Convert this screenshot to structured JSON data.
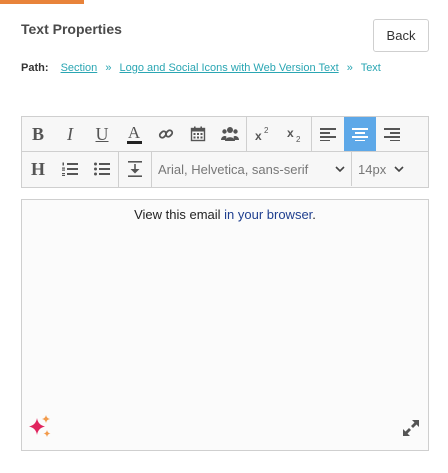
{
  "header": {
    "title": "Text Properties",
    "back_label": "Back"
  },
  "path": {
    "label": "Path:",
    "crumbs": [
      "Section",
      "Logo and Social Icons with Web Version Text"
    ],
    "current": "Text",
    "separator": "»"
  },
  "toolbar": {
    "row1": [
      "bold",
      "italic",
      "underline",
      "text-color",
      "link",
      "calendar",
      "users",
      "superscript",
      "subscript",
      "align-left",
      "align-center",
      "align-right"
    ],
    "active": "align-center",
    "font_family": "Arial, Helvetica, sans-serif",
    "font_size": "14px",
    "labels": {
      "bold": "B",
      "italic": "I",
      "underline": "U",
      "text_color": "A",
      "heading": "H"
    }
  },
  "editor": {
    "text_before": "View this email ",
    "link_text": "in your browser",
    "text_after": "."
  },
  "colors": {
    "accent": "#e8833a",
    "link": "#2aa6b3",
    "active": "#5da8e8",
    "sparkle_pink": "#e0245e",
    "sparkle_orange": "#f29b4c"
  }
}
